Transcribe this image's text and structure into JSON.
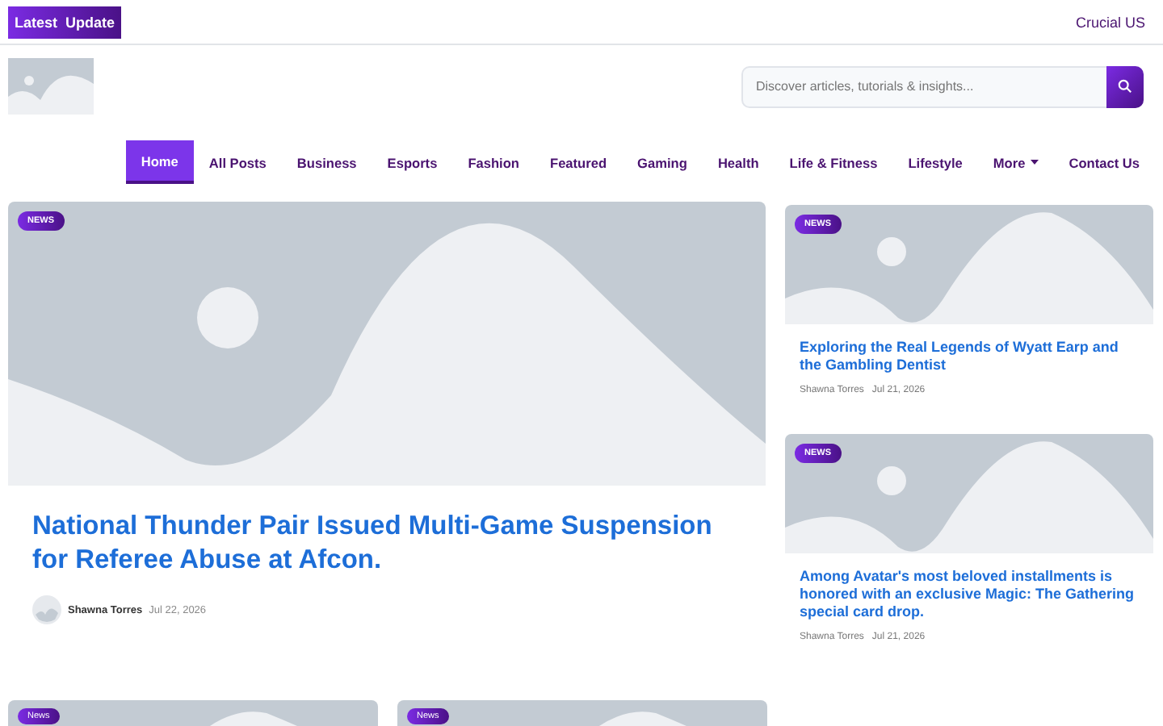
{
  "topbar": {
    "latest_button": "Latest  Update",
    "region_link": "Crucial US"
  },
  "search": {
    "placeholder": "Discover articles, tutorials & insights..."
  },
  "nav": [
    {
      "label": "Home",
      "selected": true
    },
    {
      "label": "All Posts",
      "selected": false
    },
    {
      "label": "Business",
      "selected": false
    },
    {
      "label": "Esports",
      "selected": false
    },
    {
      "label": "Fashion",
      "selected": false
    },
    {
      "label": "Featured",
      "selected": false
    },
    {
      "label": "Gaming",
      "selected": false
    },
    {
      "label": "Health",
      "selected": false
    },
    {
      "label": "Life & Fitness",
      "selected": false
    },
    {
      "label": "Lifestyle",
      "selected": false
    },
    {
      "label": "More",
      "selected": false,
      "dropdown": true
    },
    {
      "label": "Contact Us",
      "selected": false
    }
  ],
  "featured": {
    "badge": "NEWS",
    "title": "National Thunder Pair Issued Multi-Game Suspension for Referee Abuse at Afcon.",
    "author": "Shawna Torres",
    "date": "Jul 22, 2026"
  },
  "side_posts": [
    {
      "badge": "NEWS",
      "title": "Exploring the Real Legends of Wyatt Earp and the Gambling Dentist",
      "author": "Shawna Torres",
      "date": "Jul 21, 2026"
    },
    {
      "badge": "NEWS",
      "title": "Among Avatar's most beloved installments is honored with an exclusive Magic: The Gathering special card drop.",
      "author": "Shawna Torres",
      "date": "Jul 21, 2026"
    }
  ],
  "bottom_posts": [
    {
      "badge": "News"
    },
    {
      "badge": "News"
    }
  ]
}
